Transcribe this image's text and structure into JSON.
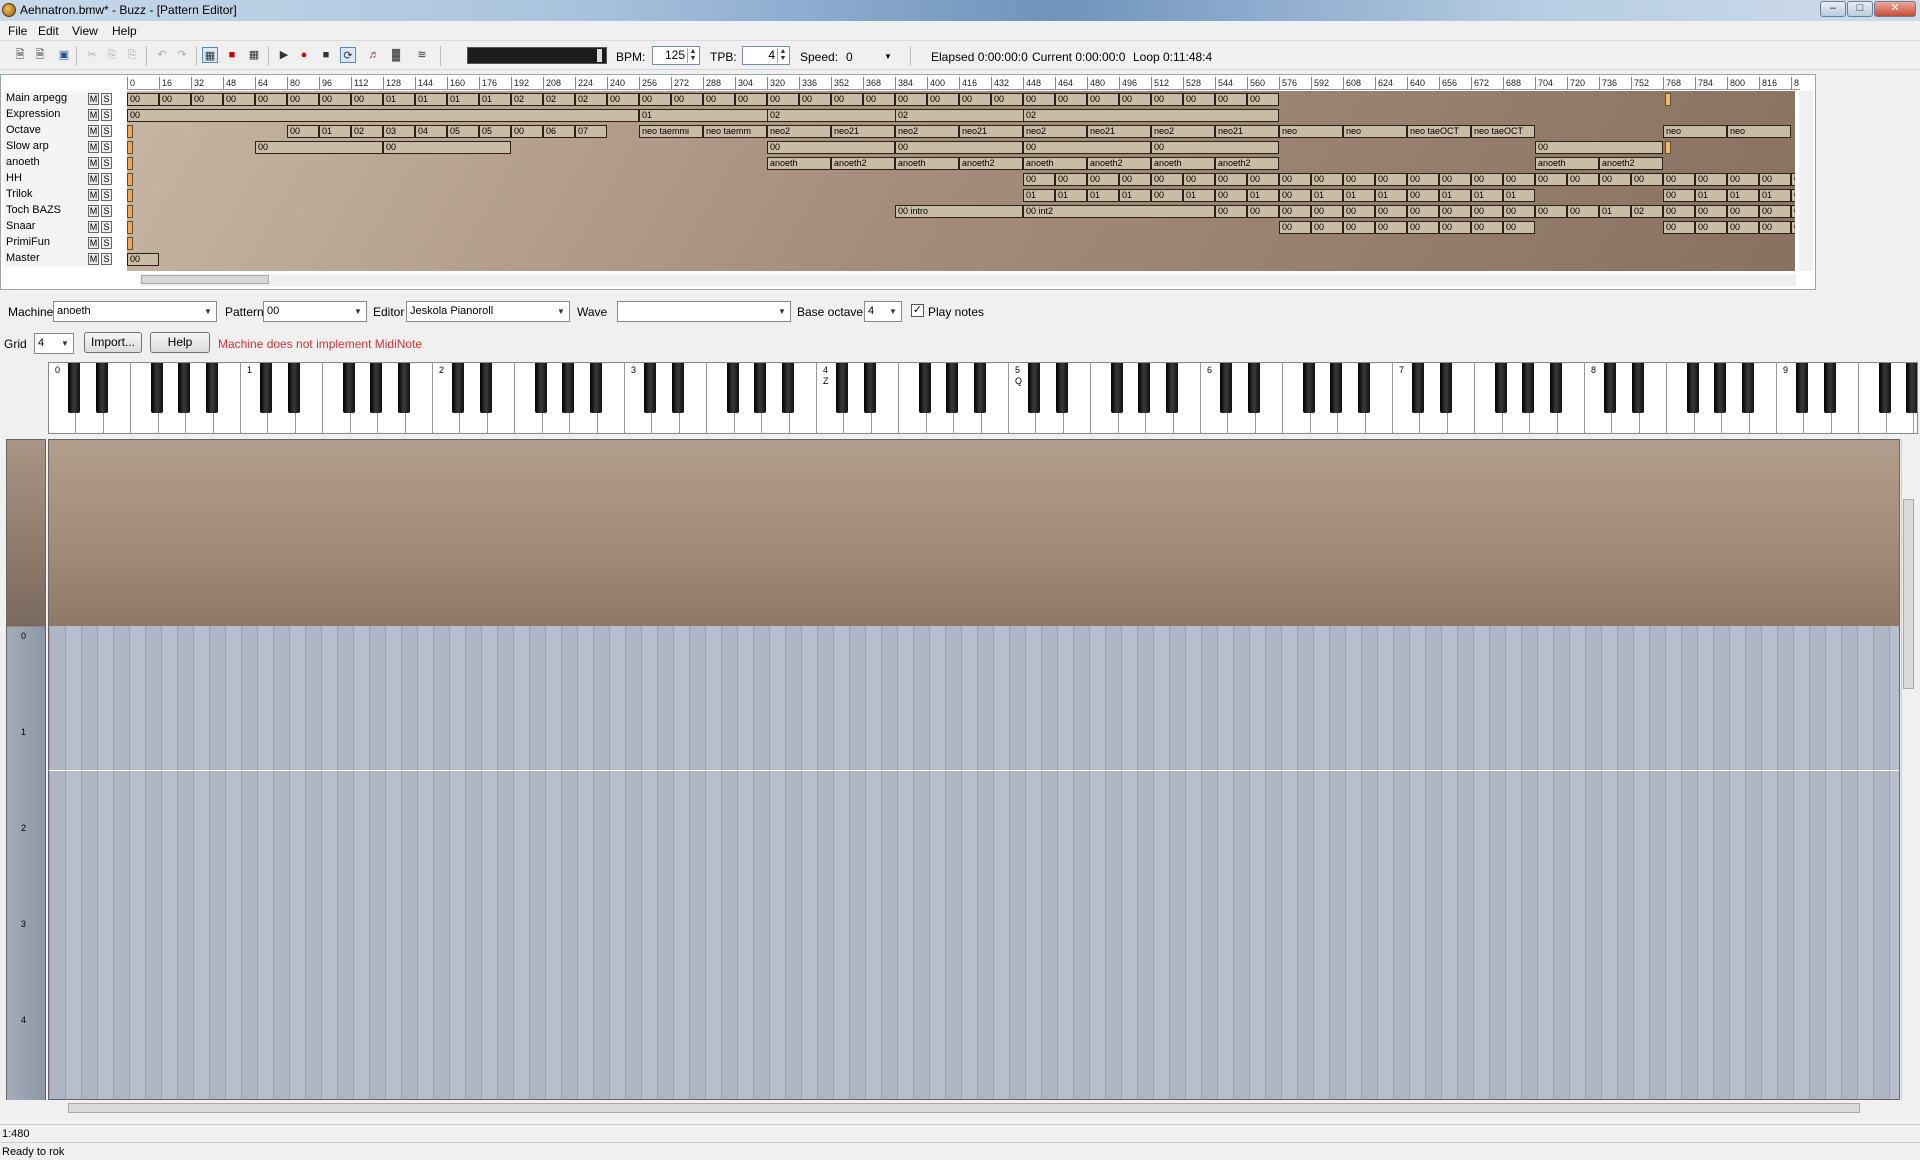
{
  "window": {
    "title": "Aehnatron.bmw* - Buzz - [Pattern Editor]"
  },
  "menu": [
    "File",
    "Edit",
    "View",
    "Help"
  ],
  "toolbar": {
    "bpm_label": "BPM:",
    "bpm_value": "125",
    "tpb_label": "TPB:",
    "tpb_value": "4",
    "speed_label": "Speed:",
    "speed_value": "0",
    "elapsed": "Elapsed 0:00:00:0",
    "current": "Current 0:00:00:0",
    "loop": "Loop 0:11:48:4"
  },
  "sequencer": {
    "ruler": [
      "0",
      "16",
      "32",
      "48",
      "64",
      "80",
      "96",
      "112",
      "128",
      "144",
      "160",
      "176",
      "192",
      "208",
      "224",
      "240",
      "256",
      "272",
      "288",
      "304",
      "320",
      "336",
      "352",
      "368",
      "384",
      "400",
      "416",
      "432",
      "448",
      "464",
      "480",
      "496",
      "512",
      "528",
      "544",
      "560",
      "576",
      "592",
      "608",
      "624",
      "640",
      "656",
      "672",
      "688",
      "704",
      "720",
      "736",
      "752",
      "768",
      "784",
      "800",
      "816",
      "8"
    ],
    "tracks": [
      "Main arpegg",
      "Expression",
      "Octave",
      "Slow arp",
      "anoeth",
      "HH",
      "Trilok",
      "Toch BAZS",
      "Snaar",
      "PrimiFun",
      "Master"
    ],
    "mute_label": "M",
    "solo_label": "S",
    "rows": [
      [
        [
          0,
          "00"
        ],
        [
          1,
          "00"
        ],
        [
          2,
          "00"
        ],
        [
          3,
          "00"
        ],
        [
          4,
          "00"
        ],
        [
          5,
          "00"
        ],
        [
          6,
          "00"
        ],
        [
          7,
          "00"
        ],
        [
          8,
          "01"
        ],
        [
          9,
          "01"
        ],
        [
          10,
          "01"
        ],
        [
          11,
          "01"
        ],
        [
          12,
          "02"
        ],
        [
          13,
          "02"
        ],
        [
          14,
          "02"
        ],
        [
          15,
          "00"
        ],
        [
          16,
          "00"
        ],
        [
          17,
          "00"
        ],
        [
          18,
          "00"
        ],
        [
          19,
          "00"
        ],
        [
          20,
          "00"
        ],
        [
          21,
          "00"
        ],
        [
          22,
          "00"
        ],
        [
          23,
          "00"
        ],
        [
          24,
          "00"
        ],
        [
          25,
          "00"
        ],
        [
          26,
          "00"
        ],
        [
          27,
          "00"
        ],
        [
          28,
          "00"
        ],
        [
          29,
          "00"
        ],
        [
          30,
          "00"
        ],
        [
          31,
          "00"
        ],
        [
          32,
          "00"
        ],
        [
          33,
          "00"
        ],
        [
          34,
          "00"
        ],
        [
          35,
          "00"
        ]
      ],
      [
        [
          0,
          "00",
          16
        ],
        [
          16,
          "01",
          8
        ],
        [
          20,
          "02",
          8
        ],
        [
          24,
          "02",
          8
        ],
        [
          28,
          "02",
          8
        ]
      ],
      [
        [
          5,
          "00"
        ],
        [
          6,
          "01"
        ],
        [
          7,
          "02"
        ],
        [
          8,
          "03"
        ],
        [
          9,
          "04"
        ],
        [
          10,
          "05"
        ],
        [
          11,
          "05"
        ],
        [
          12,
          "00"
        ],
        [
          13,
          "06"
        ],
        [
          14,
          "07"
        ],
        [
          16,
          "neo taemmi",
          2
        ],
        [
          18,
          "neo taemm",
          2
        ],
        [
          20,
          "neo2",
          2
        ],
        [
          22,
          "neo21",
          2
        ],
        [
          24,
          "neo2",
          2
        ],
        [
          26,
          "neo21",
          2
        ],
        [
          28,
          "neo2",
          2
        ],
        [
          30,
          "neo21",
          2
        ],
        [
          32,
          "neo2",
          2
        ],
        [
          34,
          "neo21",
          2
        ],
        [
          36,
          "neo",
          2
        ],
        [
          38,
          "neo",
          2
        ],
        [
          40,
          "neo taeOCT",
          2
        ],
        [
          42,
          "neo taeOCT",
          2
        ],
        [
          48,
          "neo",
          2
        ],
        [
          50,
          "neo",
          2
        ]
      ],
      [
        [
          4,
          "00",
          4
        ],
        [
          8,
          "00",
          4
        ],
        [
          20,
          "00",
          4
        ],
        [
          24,
          "00",
          4
        ],
        [
          28,
          "00",
          4
        ],
        [
          32,
          "00",
          4
        ],
        [
          44,
          "00",
          4
        ]
      ],
      [
        [
          20,
          "anoeth",
          2
        ],
        [
          22,
          "anoeth2",
          2
        ],
        [
          24,
          "anoeth",
          2
        ],
        [
          26,
          "anoeth2",
          2
        ],
        [
          28,
          "anoeth",
          2
        ],
        [
          30,
          "anoeth2",
          2
        ],
        [
          32,
          "anoeth",
          2
        ],
        [
          34,
          "anoeth2",
          2
        ],
        [
          44,
          "anoeth",
          2
        ],
        [
          46,
          "anoeth2",
          2
        ]
      ],
      [
        [
          28,
          "00"
        ],
        [
          29,
          "00"
        ],
        [
          30,
          "00"
        ],
        [
          31,
          "00"
        ],
        [
          32,
          "00"
        ],
        [
          33,
          "00"
        ],
        [
          34,
          "00"
        ],
        [
          35,
          "00"
        ],
        [
          36,
          "00"
        ],
        [
          37,
          "00"
        ],
        [
          38,
          "00"
        ],
        [
          39,
          "00"
        ],
        [
          40,
          "00"
        ],
        [
          41,
          "00"
        ],
        [
          42,
          "00"
        ],
        [
          43,
          "00"
        ],
        [
          44,
          "00"
        ],
        [
          45,
          "00"
        ],
        [
          46,
          "00"
        ],
        [
          47,
          "00"
        ],
        [
          48,
          "00"
        ],
        [
          49,
          "00"
        ],
        [
          50,
          "00"
        ],
        [
          51,
          "00"
        ],
        [
          52,
          "0"
        ]
      ],
      [
        [
          28,
          "01"
        ],
        [
          29,
          "01"
        ],
        [
          30,
          "01"
        ],
        [
          31,
          "01"
        ],
        [
          32,
          "00"
        ],
        [
          33,
          "01"
        ],
        [
          34,
          "00"
        ],
        [
          35,
          "01"
        ],
        [
          36,
          "00"
        ],
        [
          37,
          "01"
        ],
        [
          38,
          "01"
        ],
        [
          39,
          "01"
        ],
        [
          40,
          "00"
        ],
        [
          41,
          "01"
        ],
        [
          42,
          "01"
        ],
        [
          43,
          "01"
        ],
        [
          48,
          "00"
        ],
        [
          49,
          "01"
        ],
        [
          50,
          "01"
        ],
        [
          51,
          "01"
        ],
        [
          52,
          "0"
        ]
      ],
      [
        [
          24,
          "00 intro",
          4
        ],
        [
          28,
          "00 int2",
          6
        ],
        [
          34,
          "00"
        ],
        [
          35,
          "00"
        ],
        [
          36,
          "00"
        ],
        [
          37,
          "00"
        ],
        [
          38,
          "00"
        ],
        [
          39,
          "00"
        ],
        [
          40,
          "00"
        ],
        [
          41,
          "00"
        ],
        [
          42,
          "00"
        ],
        [
          43,
          "00"
        ],
        [
          44,
          "00"
        ],
        [
          45,
          "00"
        ],
        [
          46,
          "01"
        ],
        [
          47,
          "02"
        ],
        [
          48,
          "00"
        ],
        [
          49,
          "00"
        ],
        [
          50,
          "00"
        ],
        [
          51,
          "00"
        ],
        [
          52,
          "0"
        ]
      ],
      [
        [
          36,
          "00"
        ],
        [
          37,
          "00"
        ],
        [
          38,
          "00"
        ],
        [
          39,
          "00"
        ],
        [
          40,
          "00"
        ],
        [
          41,
          "00"
        ],
        [
          42,
          "00"
        ],
        [
          43,
          "00"
        ],
        [
          48,
          "00"
        ],
        [
          49,
          "00"
        ],
        [
          50,
          "00"
        ],
        [
          51,
          "00"
        ],
        [
          52,
          "0"
        ]
      ],
      [],
      [
        [
          0,
          "00",
          0
        ]
      ]
    ]
  },
  "controls": {
    "machine_label": "Machine",
    "machine_value": "anoeth",
    "pattern_label": "Pattern",
    "pattern_value": "00",
    "editor_label": "Editor",
    "editor_value": "Jeskola Pianoroll",
    "wave_label": "Wave",
    "wave_value": "",
    "base_octave_label": "Base octave",
    "base_octave_value": "4",
    "play_notes_label": "Play notes",
    "grid_label": "Grid",
    "grid_value": "4",
    "import_label": "Import...",
    "help_label": "Help",
    "error_message": "Machine does not implement MidiNote"
  },
  "keyboard": {
    "octave_labels": [
      "0",
      "1",
      "2",
      "3",
      "4",
      "5",
      "6",
      "7",
      "8",
      "9"
    ],
    "key_hint_4": "Z",
    "key_hint_5": "Q"
  },
  "roll": {
    "row_labels": [
      "0",
      "1",
      "2",
      "3",
      "4"
    ]
  },
  "status": {
    "position": "1:480",
    "message": "Ready to rok"
  }
}
